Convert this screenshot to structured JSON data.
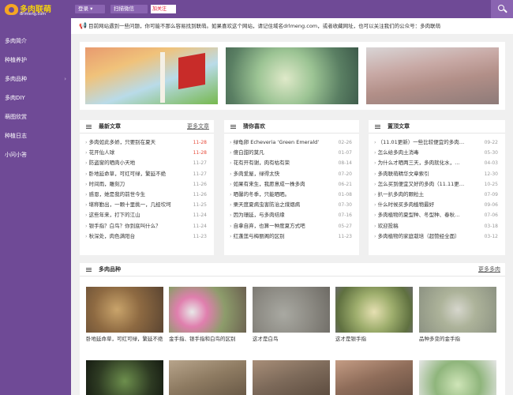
{
  "header": {
    "logo_title": "多肉联萌",
    "logo_sub": "drlmeng.com",
    "login_label": "登录 ▾",
    "scan_label": "扫描微信",
    "weibo_label": "加关注"
  },
  "sidebar": {
    "items": [
      {
        "label": "多肉简介"
      },
      {
        "label": "种植养护"
      },
      {
        "label": "多肉品种",
        "chevron": "›"
      },
      {
        "label": "多肉DIY"
      },
      {
        "label": "萌图欣赏"
      },
      {
        "label": "种植日志"
      },
      {
        "label": "小问小答"
      }
    ]
  },
  "notice": {
    "text": "目前网站遇到一些问题，你可能不那么容易找到联萌。如果喜欢这个网站，请记住域名drlmeng.com，或者收藏网址，也可以关注我们的公众号：多肉联萌"
  },
  "latest": {
    "title": "最新文章",
    "more": "更多文章",
    "items": [
      {
        "title": "多肉如此多娇，只要别在夏天",
        "date": "11-28",
        "hot": true
      },
      {
        "title": "花开仙人球",
        "date": "11-28",
        "hot": true
      },
      {
        "title": "防盗窗的晒肉小天地",
        "date": "11-27"
      },
      {
        "title": "卧地延命草，可红可绿，繁延不绝",
        "date": "11-27"
      },
      {
        "title": "时间雨，雕刻刀",
        "date": "11-26"
      },
      {
        "title": "感恩，她是我的前世今生",
        "date": "11-26"
      },
      {
        "title": "堪称勤出，一颗十里挑一，几经坎坷",
        "date": "11-25"
      },
      {
        "title": "这些年来，打下的江山",
        "date": "11-24"
      },
      {
        "title": "银手指？白鸟？你到底叫什么？",
        "date": "11-24"
      },
      {
        "title": "秋深处，肉色满阳台",
        "date": "11-23"
      }
    ]
  },
  "random": {
    "title": "猜你喜欢",
    "items": [
      {
        "title": "绿龟卵 Echeveria ‘Green Emerald’",
        "date": "02-26"
      },
      {
        "title": "傻白甜的莫凡",
        "date": "01-07"
      },
      {
        "title": "花有开有谢，肉有枯有荣",
        "date": "08-14"
      },
      {
        "title": "多肉爱屋，绿得太快",
        "date": "07-20"
      },
      {
        "title": "如果有来生，我愿意成一株多肉",
        "date": "06-21"
      },
      {
        "title": "晒馨的冬季，只能晒晒。",
        "date": "01-08"
      },
      {
        "title": "栗天度夏病虫害防治之煤烟病",
        "date": "07-30"
      },
      {
        "title": "因为珊延，与多肉结缘",
        "date": "07-16"
      },
      {
        "title": "自拿自弃，也算一种度夏方式吧",
        "date": "05-27"
      },
      {
        "title": "红蓬莲与梅丽阁的区别",
        "date": "11-23"
      }
    ]
  },
  "top": {
    "title": "置顶文章",
    "items": [
      {
        "title": "（11.01更新）一些比较便宜的多肉…",
        "date": "09-22"
      },
      {
        "title": "怎么给多肉土消毒",
        "date": "05-30"
      },
      {
        "title": "为什么才晒两三天，多肉就化水，…",
        "date": "04-03"
      },
      {
        "title": "多肉联萌精华文章索引",
        "date": "12-30"
      },
      {
        "title": "怎么买到便宜又好的多肉（11.11更…",
        "date": "10-25"
      },
      {
        "title": "扒一扒多肉的颗粒土",
        "date": "07-09"
      },
      {
        "title": "什么时候买多肉植物最好",
        "date": "09-06"
      },
      {
        "title": "多肉植物的夏型种、冬型种、春秋…",
        "date": "07-06"
      },
      {
        "title": "欢迎投稿",
        "date": "03-18"
      },
      {
        "title": "多肉植物的家庭栽培（超赞经全面）",
        "date": "03-12"
      }
    ]
  },
  "varieties": {
    "title": "多肉品种",
    "more": "更多多肉",
    "cards": [
      {
        "caption": "卧地延命草，可红可绿，繁延不绝"
      },
      {
        "caption": "金手指、银手指和白鸟的区别"
      },
      {
        "caption": "这才是白鸟"
      },
      {
        "caption": "这才是银手指"
      },
      {
        "caption": "品种多变的金手指"
      }
    ]
  },
  "colors": {
    "brand": "#6f4a96",
    "accent": "#f5d20c",
    "hot_date": "#e74c3c"
  }
}
